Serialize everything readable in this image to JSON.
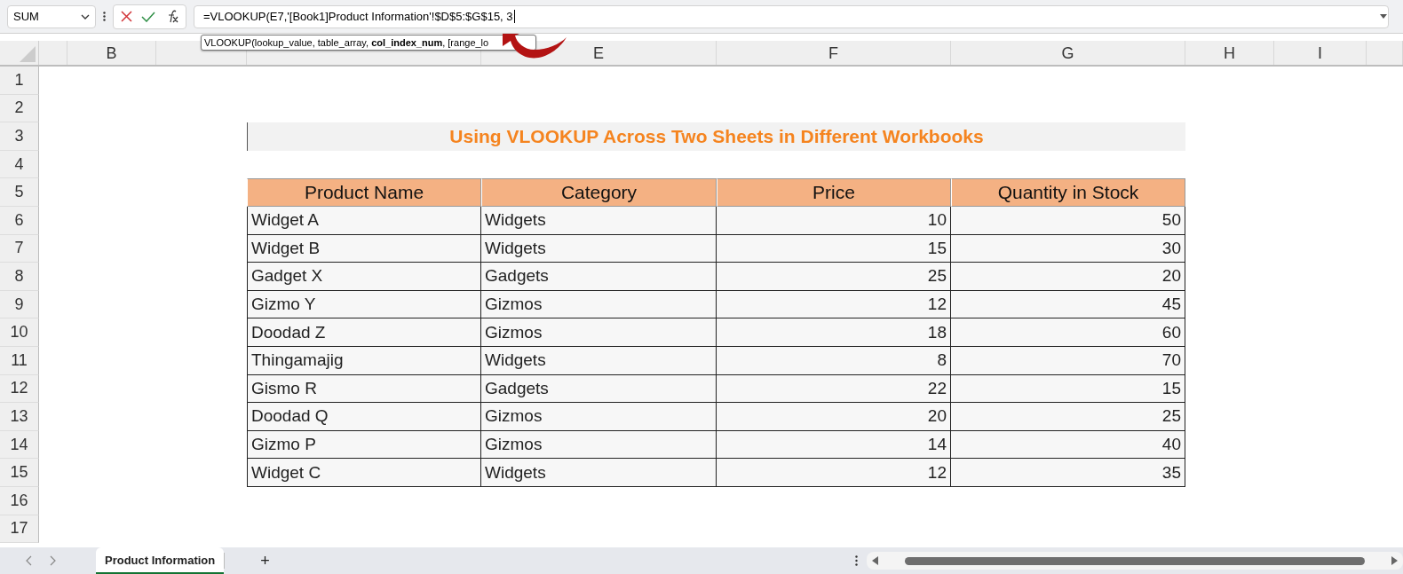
{
  "name_box": "SUM",
  "formula": "=VLOOKUP(E7,'[Book1]Product Information'!$D$5:$G$15, 3",
  "tooltip": "VLOOKUP(lookup_value, table_array, **col_index_num**, [range_lo",
  "column_headers": [
    "B",
    "E",
    "F",
    "G",
    "H",
    "I"
  ],
  "row_numbers": [
    "1",
    "2",
    "3",
    "4",
    "5",
    "6",
    "7",
    "8",
    "9",
    "10",
    "11",
    "12",
    "13",
    "14",
    "15",
    "16",
    "17"
  ],
  "title": "Using VLOOKUP Across Two Sheets in Different Workbooks",
  "table": {
    "columns": [
      "Product Name",
      "Category",
      "Price",
      "Quantity in Stock"
    ],
    "rows": [
      [
        "Widget A",
        "Widgets",
        "10",
        "50"
      ],
      [
        "Widget B",
        "Widgets",
        "15",
        "30"
      ],
      [
        "Gadget X",
        "Gadgets",
        "25",
        "20"
      ],
      [
        "Gizmo Y",
        "Gizmos",
        "12",
        "45"
      ],
      [
        "Doodad Z",
        "Gizmos",
        "18",
        "60"
      ],
      [
        "Thingamajig",
        "Widgets",
        "8",
        "70"
      ],
      [
        "Gismo R",
        "Gadgets",
        "22",
        "15"
      ],
      [
        "Doodad Q",
        "Gizmos",
        "20",
        "25"
      ],
      [
        "Gizmo P",
        "Gizmos",
        "14",
        "40"
      ],
      [
        "Widget C",
        "Widgets",
        "12",
        "35"
      ]
    ]
  },
  "sheet_tabs": [
    {
      "label": "Product Information",
      "selected": true
    }
  ],
  "add_sheet": "+"
}
